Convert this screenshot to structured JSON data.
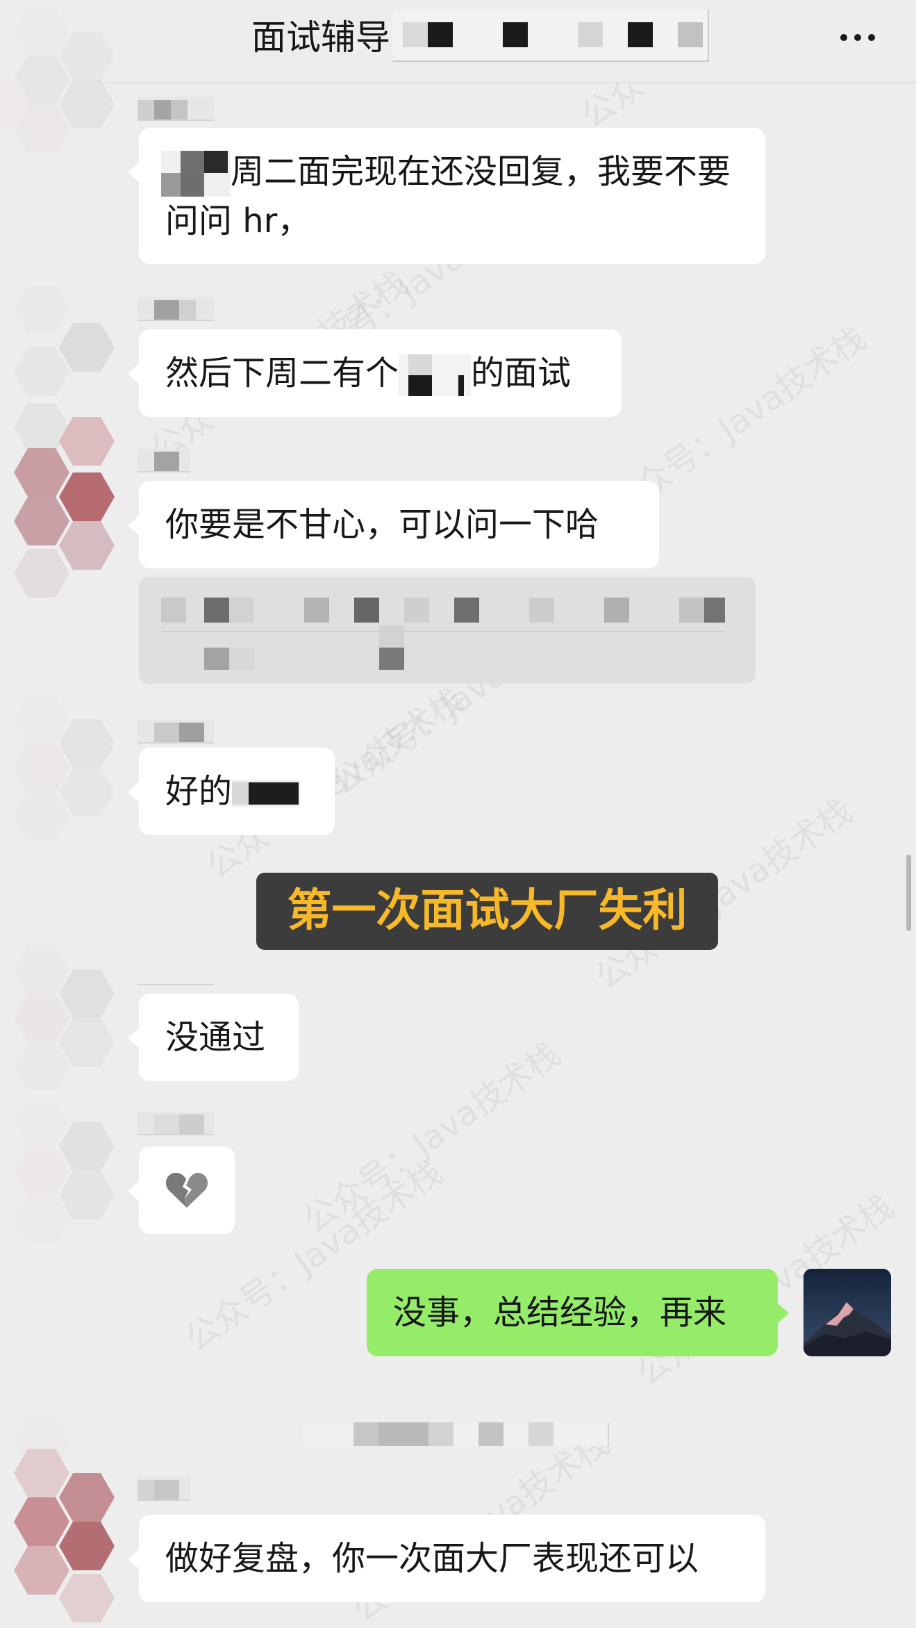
{
  "header": {
    "title": "面试辅导",
    "more_icon": "more-dots-icon"
  },
  "messages": [
    {
      "text_after_mask": "周二面完现在还没回复，我要不要问问 hr，"
    },
    {
      "text_before": "然后下周二有个",
      "text_after": "的面试"
    },
    {
      "text": "你要是不甘心，可以问一下哈"
    },
    {
      "text": "好的"
    },
    {
      "text": "没通过"
    },
    {
      "emoji": "broken-heart-icon"
    },
    {
      "text": "没事，总结经验，再来",
      "from_me": true
    },
    {
      "text": "做好复盘，你一次面大厂表现还可以"
    }
  ],
  "caption": "第一次面试大厂失利",
  "watermark": "公众号：Java技术栈",
  "colors": {
    "background": "#ededed",
    "bubble_other": "#ffffff",
    "bubble_me": "#95ec69",
    "caption_text": "#f7b928",
    "caption_bg": "#3c3c3c"
  }
}
